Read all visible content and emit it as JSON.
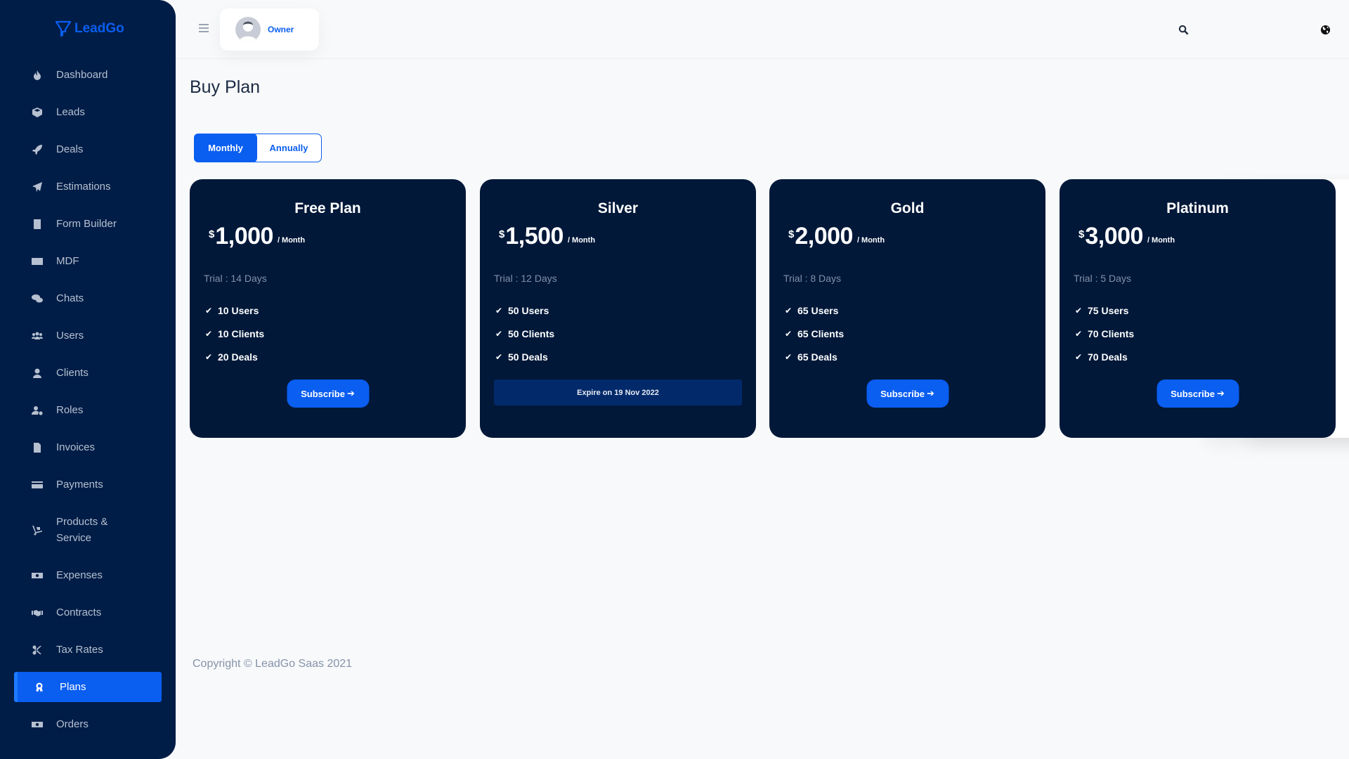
{
  "app": {
    "name": "LeadGo"
  },
  "sidebar": {
    "items": [
      {
        "label": "Dashboard",
        "icon": "fire-icon"
      },
      {
        "label": "Leads",
        "icon": "cube-icon"
      },
      {
        "label": "Deals",
        "icon": "rocket-icon"
      },
      {
        "label": "Estimations",
        "icon": "paper-plane-icon"
      },
      {
        "label": "Form Builder",
        "icon": "book-icon"
      },
      {
        "label": "MDF",
        "icon": "money-check-icon"
      },
      {
        "label": "Chats",
        "icon": "comments-icon"
      },
      {
        "label": "Users",
        "icon": "users-icon"
      },
      {
        "label": "Clients",
        "icon": "user-icon"
      },
      {
        "label": "Roles",
        "icon": "user-cog-icon"
      },
      {
        "label": "Invoices",
        "icon": "file-invoice-icon"
      },
      {
        "label": "Payments",
        "icon": "credit-card-icon"
      },
      {
        "label": "Products & Service",
        "icon": "dolly-icon"
      },
      {
        "label": "Expenses",
        "icon": "money-bill-icon"
      },
      {
        "label": "Contracts",
        "icon": "handshake-icon"
      },
      {
        "label": "Tax Rates",
        "icon": "scissors-icon"
      },
      {
        "label": "Plans",
        "icon": "award-icon",
        "active": true
      },
      {
        "label": "Orders",
        "icon": "money-bill-icon"
      }
    ]
  },
  "header": {
    "user_name": "Owner",
    "icons": [
      "search-icon",
      "envelope-icon",
      "bell-icon",
      "globe-icon"
    ]
  },
  "page": {
    "title": "Buy Plan",
    "billing_toggle": {
      "options": [
        "Monthly",
        "Annually"
      ],
      "selected": "Monthly"
    }
  },
  "plans": [
    {
      "name": "Free Plan",
      "currency": "$",
      "price": "1,000",
      "period": "/ Month",
      "trial": "Trial : 14 Days",
      "features": [
        "10 Users",
        "10 Clients",
        "20 Deals"
      ],
      "action": "Subscribe"
    },
    {
      "name": "Silver",
      "currency": "$",
      "price": "1,500",
      "period": "/ Month",
      "trial": "Trial : 12 Days",
      "features": [
        "50 Users",
        "50 Clients",
        "50 Deals"
      ],
      "expire": "Expire on 19 Nov 2022"
    },
    {
      "name": "Gold",
      "currency": "$",
      "price": "2,000",
      "period": "/ Month",
      "trial": "Trial : 8 Days",
      "features": [
        "65 Users",
        "65 Clients",
        "65 Deals"
      ],
      "action": "Subscribe"
    },
    {
      "name": "Platinum",
      "currency": "$",
      "price": "3,000",
      "period": "/ Month",
      "trial": "Trial : 5 Days",
      "features": [
        "75 Users",
        "70 Clients",
        "70 Deals"
      ],
      "action": "Subscribe"
    }
  ],
  "footer": {
    "copyright": "Copyright © LeadGo Saas 2021"
  },
  "colors": {
    "sidebar": "#001d47",
    "accent": "#0a5ef0",
    "card": "#011839",
    "expire_banner": "#022a6b"
  }
}
